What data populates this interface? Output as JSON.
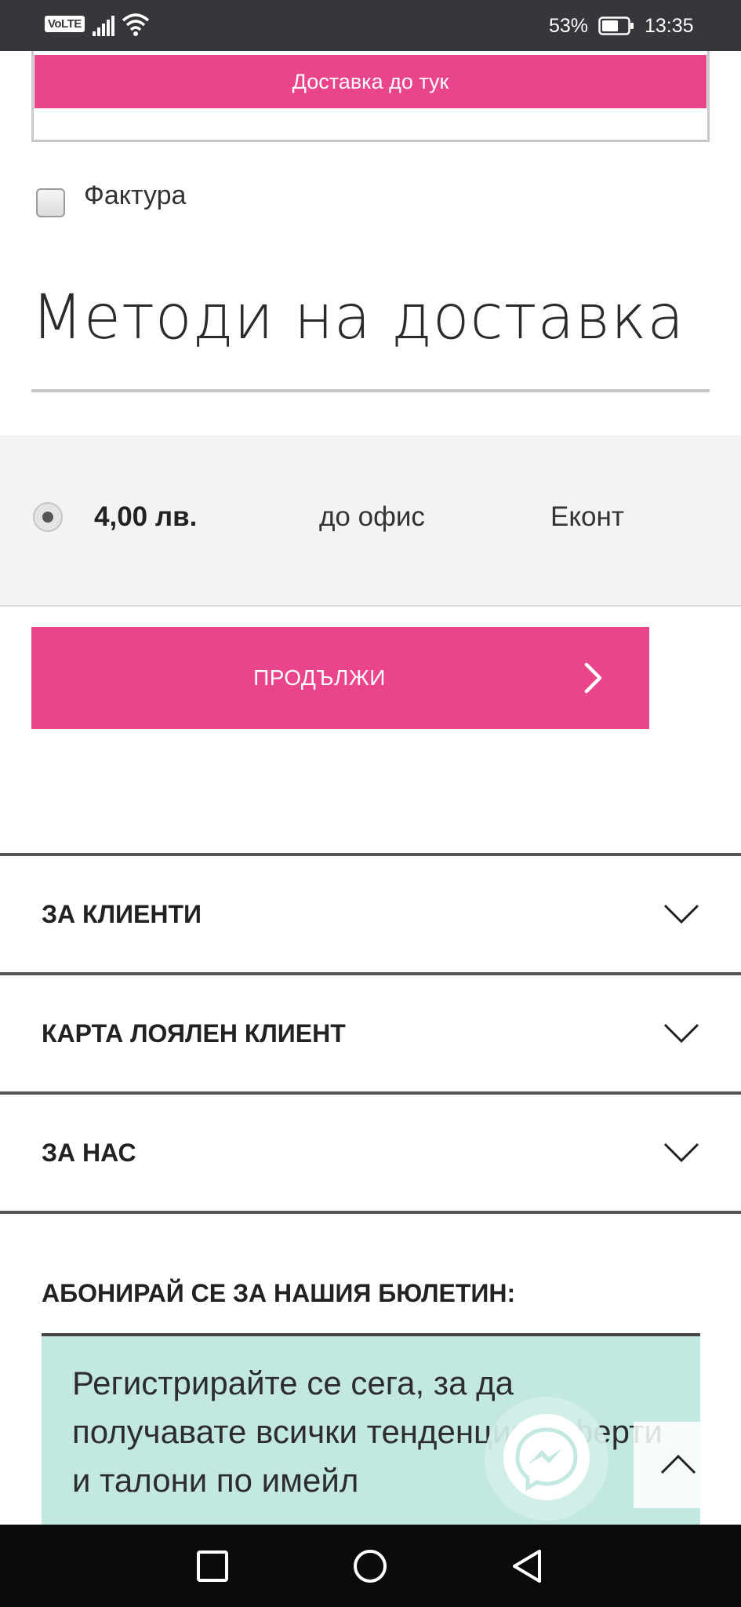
{
  "status_bar": {
    "network_badge": "VoLTE",
    "battery_percent": "53%",
    "time": "13:35"
  },
  "address": {
    "deliver_here_label": "Доставка до тук"
  },
  "invoice": {
    "label": "Фактура",
    "checked": false
  },
  "delivery_methods": {
    "title": "Методи на доставка",
    "options": [
      {
        "price": "4,00 лв.",
        "type": "до офис",
        "carrier": "Еконт",
        "selected": true
      }
    ]
  },
  "continue_button": {
    "label": "ПРОДЪЛЖИ"
  },
  "footer": {
    "accordions": [
      {
        "label": "ЗА КЛИЕНТИ"
      },
      {
        "label": "КАРТА ЛОЯЛЕН КЛИЕНТ"
      },
      {
        "label": "ЗА НАС"
      }
    ],
    "newsletter": {
      "title": "АБОНИРАЙ СЕ ЗА НАШИЯ БЮЛЕТИН:",
      "text": "Регистрирайте се сега, за да получавате всички тенденции, оферти и талони по имейл"
    }
  },
  "colors": {
    "accent_pink": "#e9448c",
    "newsletter_bg": "#c3e8e2",
    "status_bar": "#36373b"
  },
  "icons": {
    "signal": "signal-icon",
    "wifi": "wifi-icon",
    "battery": "battery-icon",
    "continue": "chevron-right-icon",
    "accordion": "chevron-down-icon",
    "messenger": "messenger-icon",
    "scroll_top": "chevron-up-icon",
    "nav_recent": "square-icon",
    "nav_home": "circle-icon",
    "nav_back": "triangle-back-icon"
  }
}
